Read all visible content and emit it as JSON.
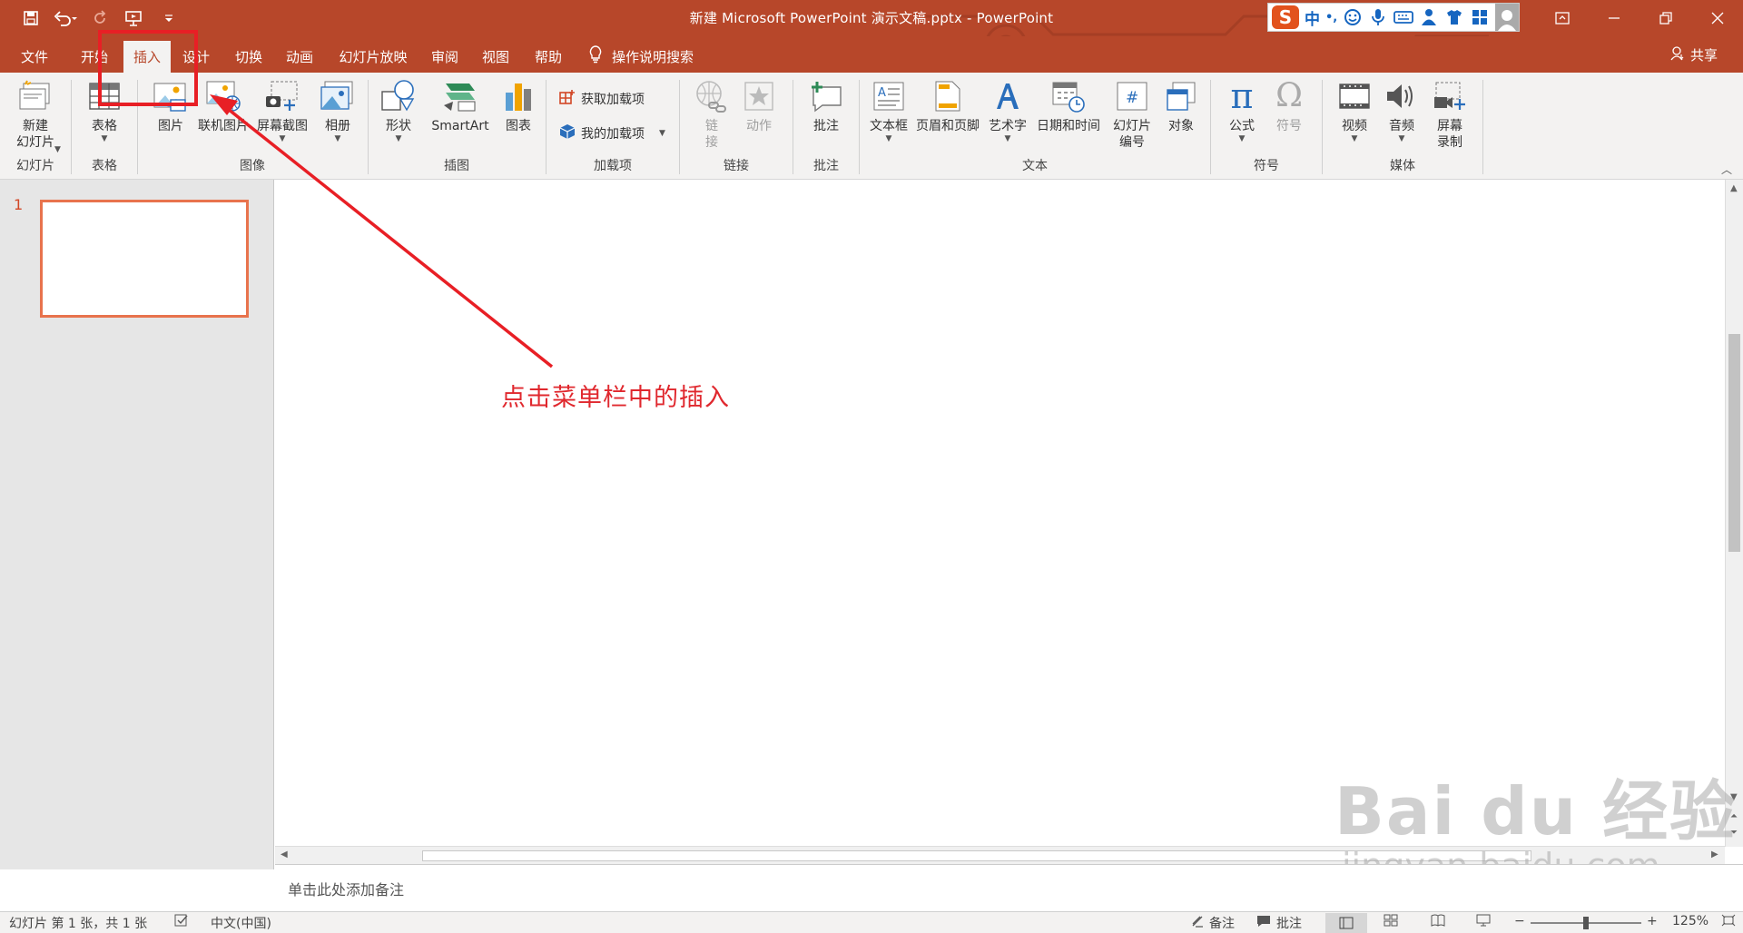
{
  "window": {
    "title": "新建 Microsoft PowerPoint 演示文稿.pptx  -  PowerPoint",
    "accent_color": "#b7472a"
  },
  "qat": {
    "save": "save-icon",
    "undo": "undo-icon",
    "redo": "redo-icon",
    "present": "present-icon",
    "customize": "customize-icon"
  },
  "ime": {
    "logo": "S",
    "mode": "中",
    "punct": "•,"
  },
  "tabs": [
    {
      "label": "文件"
    },
    {
      "label": "开始"
    },
    {
      "label": "插入"
    },
    {
      "label": "设计"
    },
    {
      "label": "切换"
    },
    {
      "label": "动画"
    },
    {
      "label": "幻灯片放映"
    },
    {
      "label": "审阅"
    },
    {
      "label": "视图"
    },
    {
      "label": "帮助"
    }
  ],
  "tell_me": "操作说明搜索",
  "share": "共享",
  "ribbon": {
    "groups": {
      "slides": "幻灯片",
      "tables": "表格",
      "images": "图像",
      "illustrations": "插图",
      "addins": "加载项",
      "links": "链接",
      "comments": "批注",
      "text": "文本",
      "symbols": "符号",
      "media": "媒体"
    },
    "buttons": {
      "new_slide_1": "新建",
      "new_slide_2": "幻灯片",
      "table": "表格",
      "picture": "图片",
      "online_picture": "联机图片",
      "screenshot": "屏幕截图",
      "album": "相册",
      "shapes": "形状",
      "smartart": "SmartArt",
      "chart": "图表",
      "get_addins": "获取加载项",
      "my_addins": "我的加载项",
      "link_1": "链",
      "link_2": "接",
      "action": "动作",
      "comment": "批注",
      "textbox": "文本框",
      "header_footer": "页眉和页脚",
      "wordart": "艺术字",
      "datetime": "日期和时间",
      "slide_number_1": "幻灯片",
      "slide_number_2": "编号",
      "object": "对象",
      "equation": "公式",
      "symbol": "符号",
      "video": "视频",
      "audio": "音频",
      "screen_rec_1": "屏幕",
      "screen_rec_2": "录制"
    }
  },
  "thumbnails": [
    {
      "number": "1"
    }
  ],
  "annotation": {
    "text": "点击菜单栏中的插入",
    "color": "#e0282e"
  },
  "notes_placeholder": "单击此处添加备注",
  "status": {
    "slide_info": "幻灯片 第 1 张，共 1 张",
    "language": "中文(中国)",
    "notes": "备注",
    "comments": "批注",
    "zoom": "125%",
    "zoom_fraction": 0.5
  },
  "watermark": {
    "brand": "Bai  du 经验",
    "url": "jingyan.baidu.com"
  }
}
